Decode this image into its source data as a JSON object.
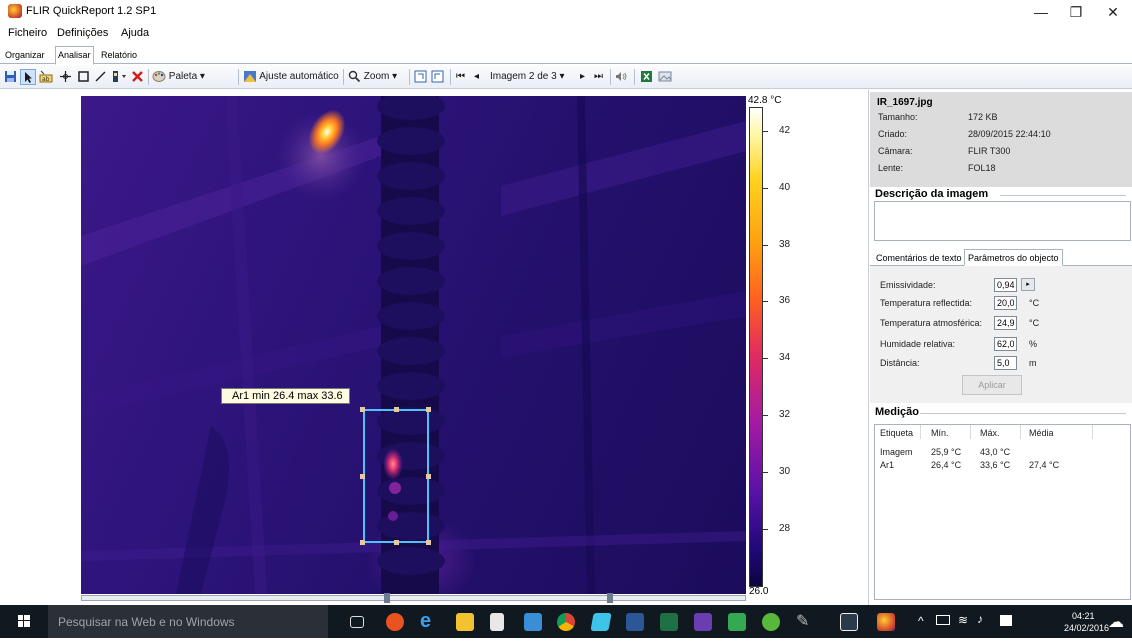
{
  "window": {
    "title": "FLIR QuickReport 1.2 SP1",
    "controls": {
      "minimize": "—",
      "maximize": "❐",
      "close": "✕"
    }
  },
  "menu": [
    "Ficheiro",
    "Definições",
    "Ajuda"
  ],
  "tabs": [
    {
      "label": "Organizar",
      "active": false
    },
    {
      "label": "Analisar",
      "active": true
    },
    {
      "label": "Relatório",
      "active": false
    }
  ],
  "toolbar": {
    "palette_label": "Paleta",
    "auto_adjust_label": "Ajuste automático",
    "zoom_label": "Zoom",
    "image_nav_label": "Imagem 2 de 3"
  },
  "ir_image": {
    "measure_label": "Ar1 min 26.4 max 33.6",
    "scale_unit_top": "42.8 °C",
    "scale_ticks": [
      "42",
      "40",
      "38",
      "36",
      "34",
      "32",
      "30",
      "28"
    ],
    "scale_bottom": "26.0",
    "scale_max": 42.8,
    "scale_min": 26.0
  },
  "file_info": {
    "filename": "IR_1697.jpg",
    "rows": [
      {
        "key": "Tamanho:",
        "value": "172 KB"
      },
      {
        "key": "Criado:",
        "value": "28/09/2015 22:44:10"
      },
      {
        "key": "Câmara:",
        "value": "FLIR T300"
      },
      {
        "key": "Lente:",
        "value": "FOL18"
      }
    ]
  },
  "description": {
    "title": "Descrição da imagem"
  },
  "object_tabs": [
    {
      "label": "Comentários de texto",
      "active": false
    },
    {
      "label": "Parâmetros do objecto",
      "active": true
    }
  ],
  "params": [
    {
      "key": "Emissividade:",
      "value": "0,94",
      "unit": ""
    },
    {
      "key": "Temperatura reflectida:",
      "value": "20,0",
      "unit": "°C"
    },
    {
      "key": "Temperatura atmosférica:",
      "value": "24,9",
      "unit": "°C"
    },
    {
      "key": "Humidade relativa:",
      "value": "62,0",
      "unit": "%"
    },
    {
      "key": "Distância:",
      "value": "5,0",
      "unit": "m"
    }
  ],
  "apply_label": "Aplicar",
  "measurement": {
    "title": "Medição",
    "headers": [
      "Etiqueta",
      "Mín.",
      "Máx.",
      "Média"
    ],
    "rows": [
      [
        "Imagem",
        "25,9 °C",
        "43,0 °C",
        ""
      ],
      [
        "Ar1",
        "26,4 °C",
        "33,6 °C",
        "27,4 °C"
      ]
    ]
  },
  "taskbar": {
    "search_placeholder": "Pesquisar na Web e no Windows",
    "time": "04:21",
    "date": "24/02/2016"
  },
  "colors": {
    "scale_hot": "#ffffff",
    "scale_cold": "#0a0440",
    "measure_box": "#4fc3f7",
    "taskbar_bg": "#101820"
  }
}
